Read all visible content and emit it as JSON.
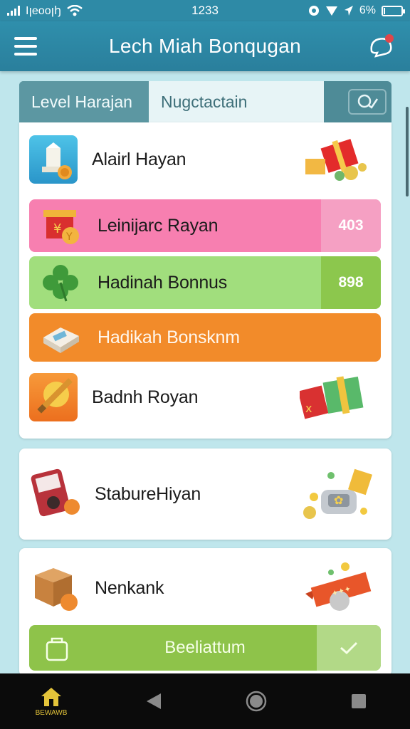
{
  "status_bar": {
    "carrier": "Iꞁeooꞁꜧ",
    "time": "1233",
    "battery": "6%",
    "battery_level": 0.06
  },
  "app_bar": {
    "title": "Lech Miah Bonqugan"
  },
  "tabs": [
    {
      "label": "Level Harajan"
    },
    {
      "label": "Nugctactain"
    }
  ],
  "card1": {
    "rows": [
      {
        "label": "Alairl Hayan",
        "icon": "lamp-icon"
      },
      {
        "label": "Leinijarc Rayan",
        "badge": "403",
        "icon": "gift-coin-icon",
        "color": "#f77fb0",
        "badge_color": "#f5a0c3"
      },
      {
        "label": "Hadinah Bonnus",
        "badge": "898",
        "icon": "clover-icon",
        "color": "#a1de7d",
        "badge_color": "#8cc74d"
      },
      {
        "label": "Hadikah Bonsknm",
        "icon": "tray-icon",
        "color": "#f28b2a"
      },
      {
        "label": "Badnh Royan",
        "icon": "pencil-icon"
      }
    ]
  },
  "card2": {
    "label": "StabureHiyan",
    "icon": "device-icon"
  },
  "card3": {
    "label": "Nenkank",
    "icon": "box-icon",
    "cta_label": "Beeliattum"
  },
  "nav": {
    "home_label": "BEWAWB"
  },
  "colors": {
    "primary": "#2e8aa6",
    "pink": "#f77fb0",
    "green": "#a1de7d",
    "orange": "#f28b2a",
    "cta": "#8ec34a"
  }
}
